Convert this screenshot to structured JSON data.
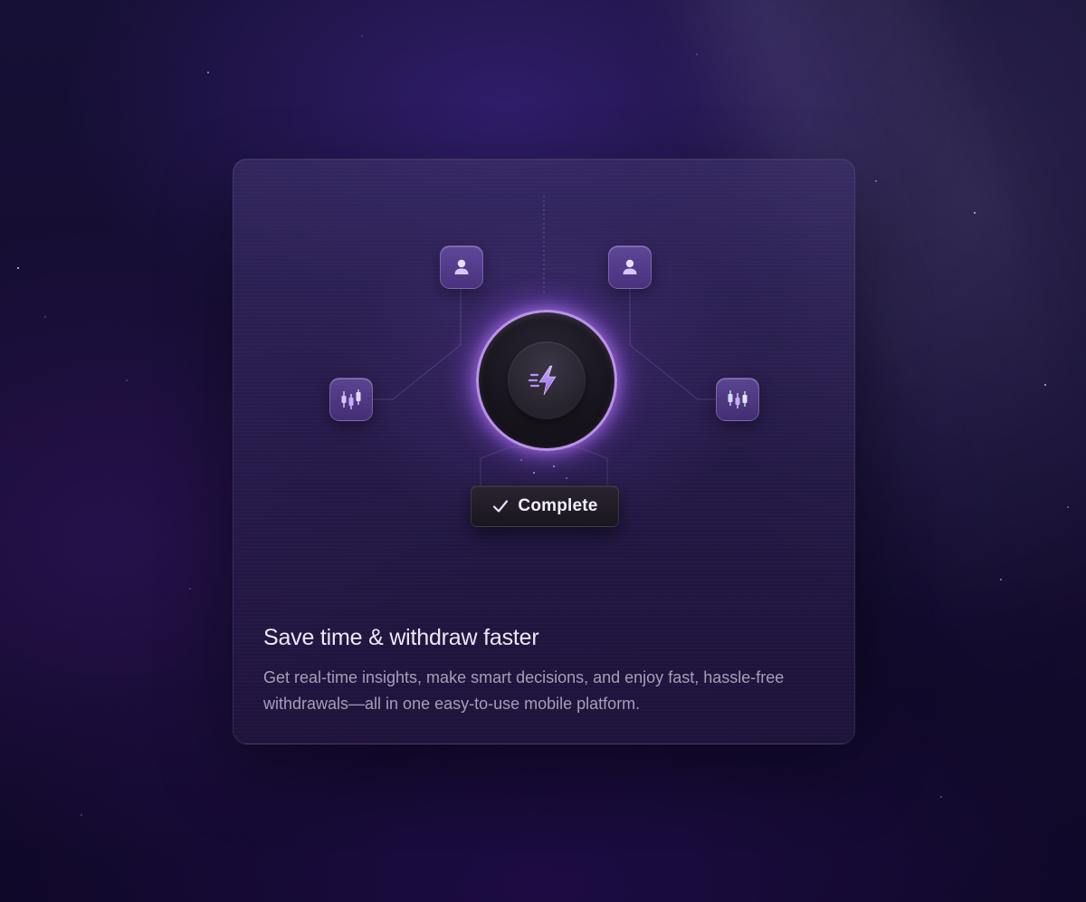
{
  "feature_card": {
    "title": "Save time & withdraw faster",
    "description": "Get real-time insights, make smart decisions, and enjoy fast, hassle-free withdrawals—all in one easy-to-use mobile platform.",
    "status_label": "Complete"
  },
  "icons": {
    "hub": "lightning-bolt-icon",
    "nodes": [
      "user-icon",
      "user-icon",
      "candlestick-chart-icon",
      "candlestick-chart-icon"
    ],
    "status": "checkmark-icon"
  },
  "colors": {
    "accent": "#b98cff",
    "background": "#140c30",
    "title": "#ece8f6",
    "body": "#a59fb8"
  }
}
